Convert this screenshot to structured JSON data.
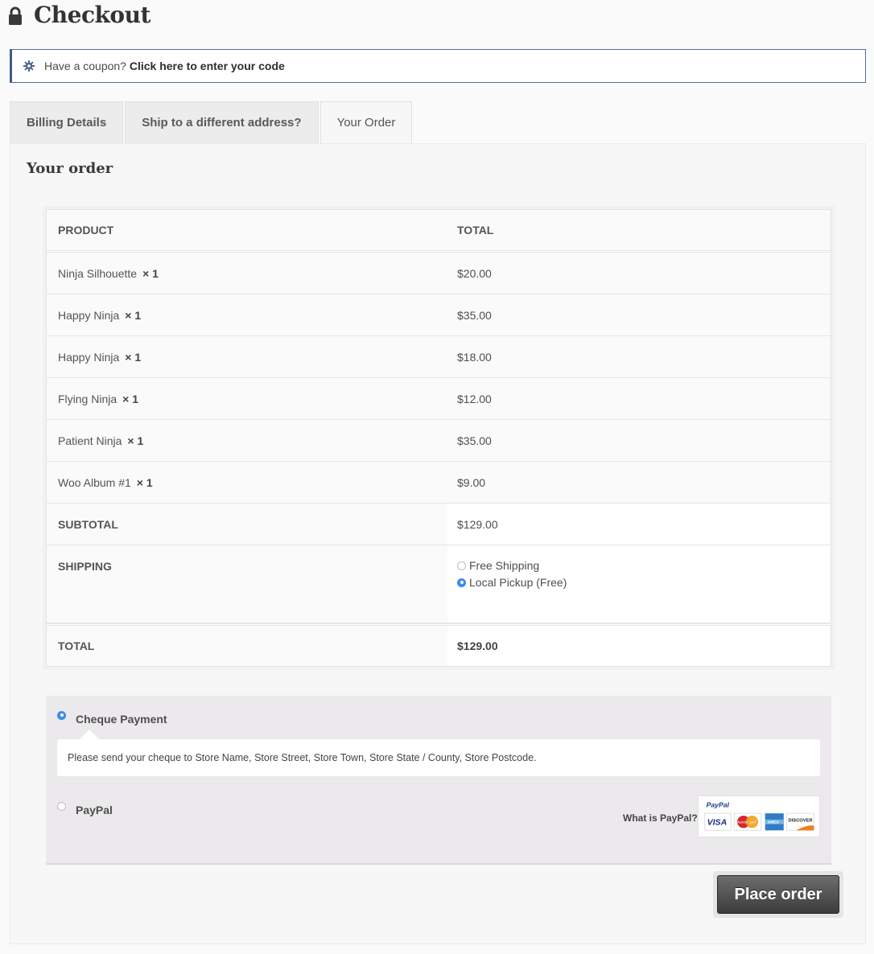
{
  "header": {
    "title": "Checkout"
  },
  "coupon": {
    "prefix": "Have a coupon?",
    "link": "Click here to enter your code"
  },
  "tabs": [
    {
      "label": "Billing Details"
    },
    {
      "label": "Ship to a different address?"
    },
    {
      "label": "Your Order"
    }
  ],
  "order": {
    "heading": "Your order",
    "columns": {
      "product": "PRODUCT",
      "total": "TOTAL"
    },
    "items": [
      {
        "name": "Ninja Silhouette",
        "qty": "× 1",
        "total": "$20.00"
      },
      {
        "name": "Happy Ninja",
        "qty": "× 1",
        "total": "$35.00"
      },
      {
        "name": "Happy Ninja",
        "qty": "× 1",
        "total": "$18.00"
      },
      {
        "name": "Flying Ninja",
        "qty": "× 1",
        "total": "$12.00"
      },
      {
        "name": "Patient Ninja",
        "qty": "× 1",
        "total": "$35.00"
      },
      {
        "name": "Woo Album #1",
        "qty": "× 1",
        "total": "$9.00"
      }
    ],
    "subtotal": {
      "label": "SUBTOTAL",
      "value": "$129.00"
    },
    "shipping": {
      "label": "SHIPPING",
      "options": [
        {
          "label": "Free Shipping",
          "selected": false
        },
        {
          "label": "Local Pickup (Free)",
          "selected": true
        }
      ]
    },
    "total": {
      "label": "TOTAL",
      "value": "$129.00"
    }
  },
  "payment": {
    "methods": [
      {
        "label": "Cheque Payment",
        "selected": true
      },
      {
        "label": "PayPal",
        "selected": false
      }
    ],
    "cheque_description": "Please send your cheque to Store Name, Store Street, Store Town, Store State / County, Store Postcode.",
    "what_is_paypal": "What is PayPal?",
    "paypal_logo": {
      "brand": "PayPal",
      "cards": [
        "VISA",
        "MasterCard",
        "AMEX",
        "DISCOVER"
      ]
    }
  },
  "place_order": {
    "label": "Place order"
  },
  "colors": {
    "accent": "#3b8beb",
    "notice_border": "#3d5b8c",
    "button": "#4a4a4a"
  },
  "icons": {
    "title": "lock-icon",
    "coupon": "gear-icon"
  }
}
